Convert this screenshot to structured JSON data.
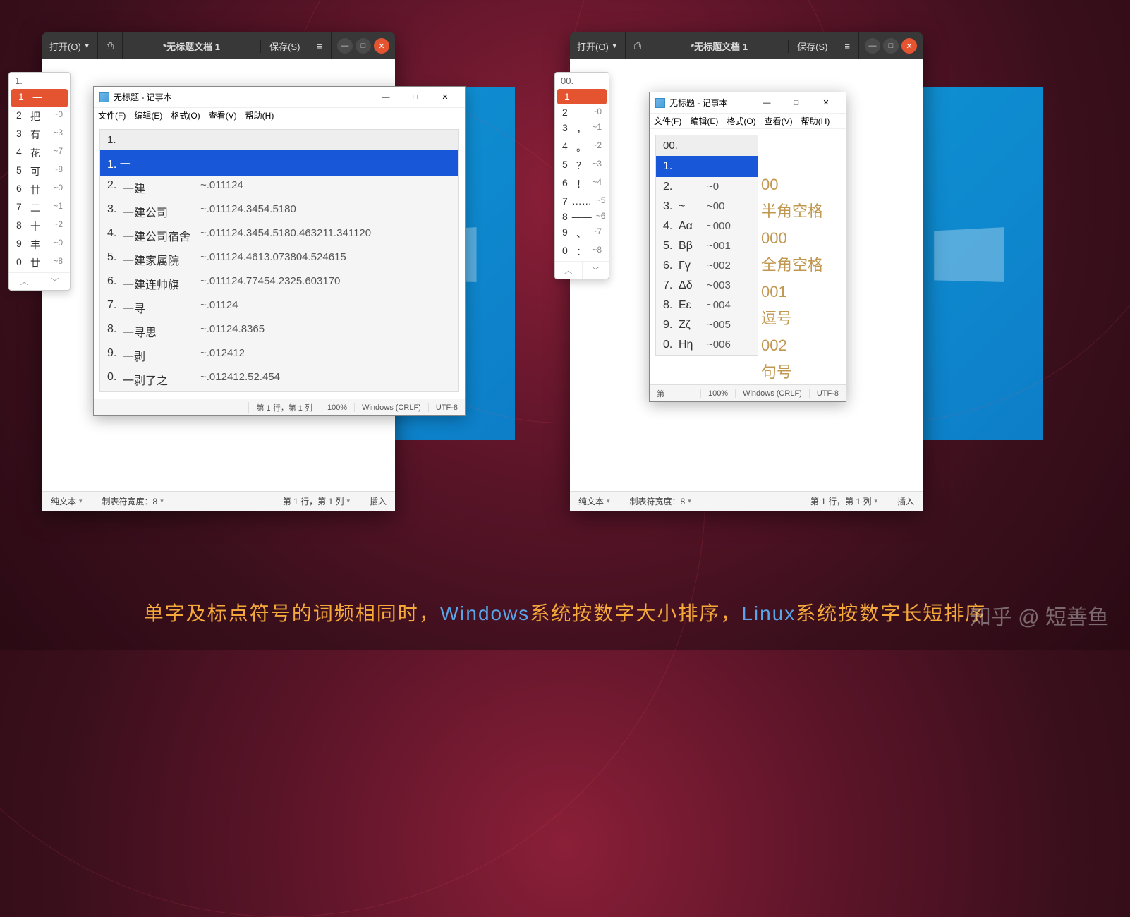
{
  "gedit": {
    "open": "打开(O)",
    "title": "*无标题文档 1",
    "save": "保存(S)"
  },
  "ime_left": {
    "head": "1.",
    "rows": [
      {
        "n": "1",
        "w": "一",
        "c": ""
      },
      {
        "n": "2",
        "w": "把",
        "c": "~0"
      },
      {
        "n": "3",
        "w": "有",
        "c": "~3"
      },
      {
        "n": "4",
        "w": "花",
        "c": "~7"
      },
      {
        "n": "5",
        "w": "可",
        "c": "~8"
      },
      {
        "n": "6",
        "w": "廿",
        "c": "~0"
      },
      {
        "n": "7",
        "w": "二",
        "c": "~1"
      },
      {
        "n": "8",
        "w": "十",
        "c": "~2"
      },
      {
        "n": "9",
        "w": "丰",
        "c": "~0"
      },
      {
        "n": "0",
        "w": "廿",
        "c": "~8"
      }
    ]
  },
  "ime_right": {
    "head": "00.",
    "rows": [
      {
        "n": "1",
        "w": "",
        "c": ""
      },
      {
        "n": "2",
        "w": "",
        "c": "~0"
      },
      {
        "n": "3",
        "w": "，",
        "c": "~1"
      },
      {
        "n": "4",
        "w": "。",
        "c": " ~2"
      },
      {
        "n": "5",
        "w": "？",
        "c": "~3"
      },
      {
        "n": "6",
        "w": "！",
        "c": "~4"
      },
      {
        "n": "7",
        "w": "……",
        "c": "~5"
      },
      {
        "n": "8",
        "w": "——",
        "c": "~6"
      },
      {
        "n": "9",
        "w": "、",
        "c": "~7"
      },
      {
        "n": "0",
        "w": "：",
        "c": "~8"
      }
    ]
  },
  "notepad": {
    "title": "无标题 - 记事本",
    "menu": [
      "文件(F)",
      "编辑(E)",
      "格式(O)",
      "查看(V)",
      "帮助(H)"
    ],
    "status_left": {
      "pos": "第 1 行，第 1 列",
      "zoom": "100%",
      "eol": "Windows (CRLF)",
      "enc": "UTF-8"
    },
    "status_right": {
      "pre": "第",
      "zoom": "100%",
      "eol": "Windows (CRLF)",
      "enc": "UTF-8"
    }
  },
  "cand_left": {
    "head": "1.",
    "sel": "1. 一",
    "rows": [
      {
        "n": "2.",
        "w": "一建",
        "c": "~.011124"
      },
      {
        "n": "3.",
        "w": "一建公司",
        "c": "~.011124.3454.5180"
      },
      {
        "n": "4.",
        "w": "一建公司宿舍",
        "c": "~.011124.3454.5180.463211.341120"
      },
      {
        "n": "5.",
        "w": "一建家属院",
        "c": "~.011124.4613.073804.524615"
      },
      {
        "n": "6.",
        "w": "一建连帅旗",
        "c": "~.011124.77454.2325.603170"
      },
      {
        "n": "7.",
        "w": "一寻",
        "c": "~.01124"
      },
      {
        "n": "8.",
        "w": "一寻思",
        "c": "~.01124.8365"
      },
      {
        "n": "9.",
        "w": "一剥",
        "c": "~.012412"
      },
      {
        "n": "0.",
        "w": "一剥了之",
        "c": "~.012412.52.454"
      }
    ]
  },
  "cand_right": {
    "head": "00.",
    "sel": "1.",
    "rows": [
      {
        "n": "2.",
        "w": "",
        "c": "~0"
      },
      {
        "n": "3.",
        "w": "~",
        "c": "~00"
      },
      {
        "n": "4.",
        "w": "Αα",
        "c": "~000"
      },
      {
        "n": "5.",
        "w": "Ββ",
        "c": "~001"
      },
      {
        "n": "6.",
        "w": "Γγ",
        "c": "~002"
      },
      {
        "n": "7.",
        "w": "Δδ",
        "c": "~003"
      },
      {
        "n": "8.",
        "w": "Εε",
        "c": "~004"
      },
      {
        "n": "9.",
        "w": "Ζζ",
        "c": "~005"
      },
      {
        "n": "0.",
        "w": "Ηη",
        "c": "~006"
      }
    ],
    "labels": [
      "00",
      "半角空格",
      "000",
      "全角空格",
      "001",
      "逗号",
      "002",
      "句号"
    ]
  },
  "gedit_status": {
    "ft": "纯文本",
    "tab": "制表符宽度：8",
    "pos": "第 1 行，第 1 列",
    "ins": "插入"
  },
  "caption_a": "单字及标点符号的词频相同时，",
  "caption_b": "Windows",
  "caption_c": "系统按数字大小排序，",
  "caption_d": "Linux",
  "caption_e": "系统按数字长短排序",
  "watermark": "知乎 @ 短善鱼"
}
